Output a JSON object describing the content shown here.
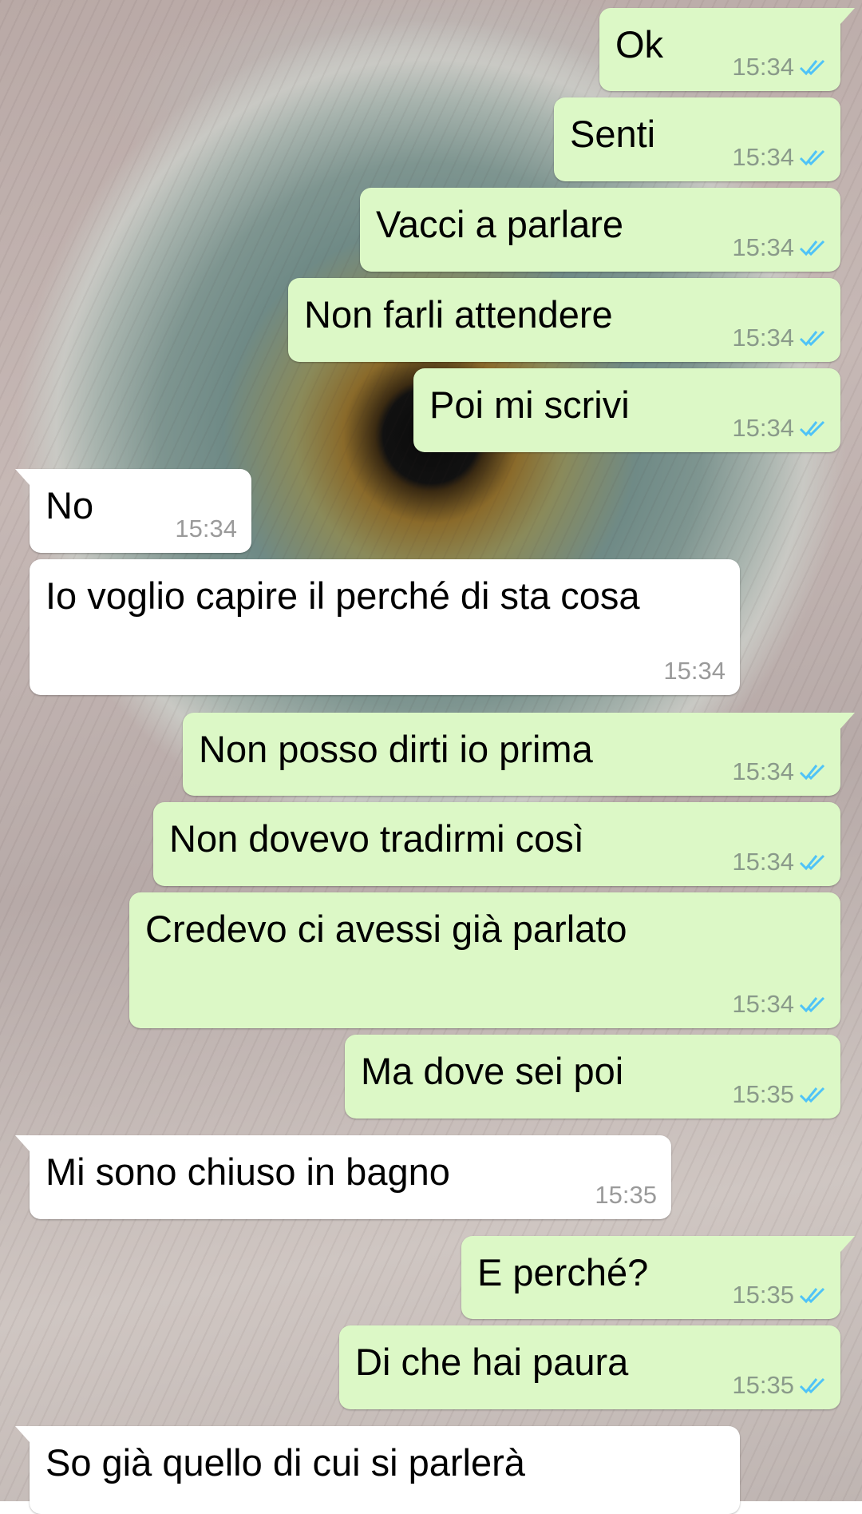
{
  "colors": {
    "outgoing_bubble": "#dcf8c6",
    "incoming_bubble": "#ffffff",
    "read_ticks": "#4fc3f7"
  },
  "icons": {
    "read_receipt": "double-check-icon"
  },
  "messages": [
    {
      "dir": "out",
      "text": "Ok",
      "time": "15:34"
    },
    {
      "dir": "out",
      "text": "Senti",
      "time": "15:34"
    },
    {
      "dir": "out",
      "text": "Vacci a parlare",
      "time": "15:34"
    },
    {
      "dir": "out",
      "text": "Non farli attendere",
      "time": "15:34"
    },
    {
      "dir": "out",
      "text": "Poi mi scrivi",
      "time": "15:34"
    },
    {
      "dir": "in",
      "text": "No",
      "time": "15:34"
    },
    {
      "dir": "in",
      "text": "Io voglio capire il perché di sta cosa",
      "time": "15:34"
    },
    {
      "dir": "out",
      "text": "Non posso dirti io prima",
      "time": "15:34"
    },
    {
      "dir": "out",
      "text": "Non dovevo tradirmi così",
      "time": "15:34"
    },
    {
      "dir": "out",
      "text": "Credevo ci avessi già parlato",
      "time": "15:34"
    },
    {
      "dir": "out",
      "text": "Ma dove sei poi",
      "time": "15:35"
    },
    {
      "dir": "in",
      "text": "Mi sono chiuso in bagno",
      "time": "15:35"
    },
    {
      "dir": "out",
      "text": "E perché?",
      "time": "15:35"
    },
    {
      "dir": "out",
      "text": "Di che hai paura",
      "time": "15:35"
    },
    {
      "dir": "in",
      "text": "So già quello di cui si parlerà",
      "time": ""
    }
  ]
}
